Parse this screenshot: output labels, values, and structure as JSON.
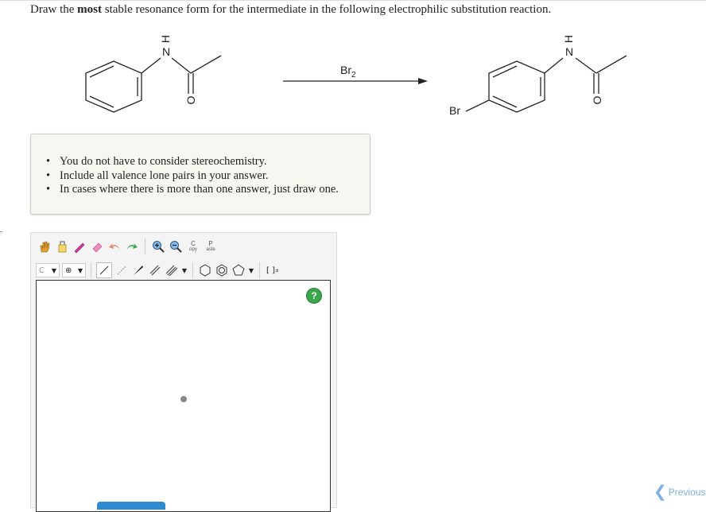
{
  "question": {
    "prefix": "Draw the ",
    "bold": "most",
    "suffix": " stable resonance form for the intermediate in the following electrophilic substitution reaction."
  },
  "scheme": {
    "reactant_labels": {
      "N": "N",
      "H": "H",
      "O": "O"
    },
    "reagent": {
      "main": "Br",
      "sub": "2"
    },
    "product_labels": {
      "N": "N",
      "H": "H",
      "O": "O",
      "Br": "Br"
    }
  },
  "instructions": [
    "You do not have to consider stereochemistry.",
    "Include all valence lone pairs in your answer.",
    "In cases where there is more than one answer, just draw one."
  ],
  "toolbar": {
    "copy_top": "C",
    "copy_bottom": "opy",
    "paste_top": "P",
    "paste_bottom": "aste",
    "element": "C",
    "bracket": "[ ]",
    "bracket_sup": "±"
  },
  "help_label": "?",
  "previous_label": "Previous",
  "colors": {
    "help": "#3aa64c",
    "link": "#7fb0e3",
    "hint": "#2e8bd0"
  }
}
